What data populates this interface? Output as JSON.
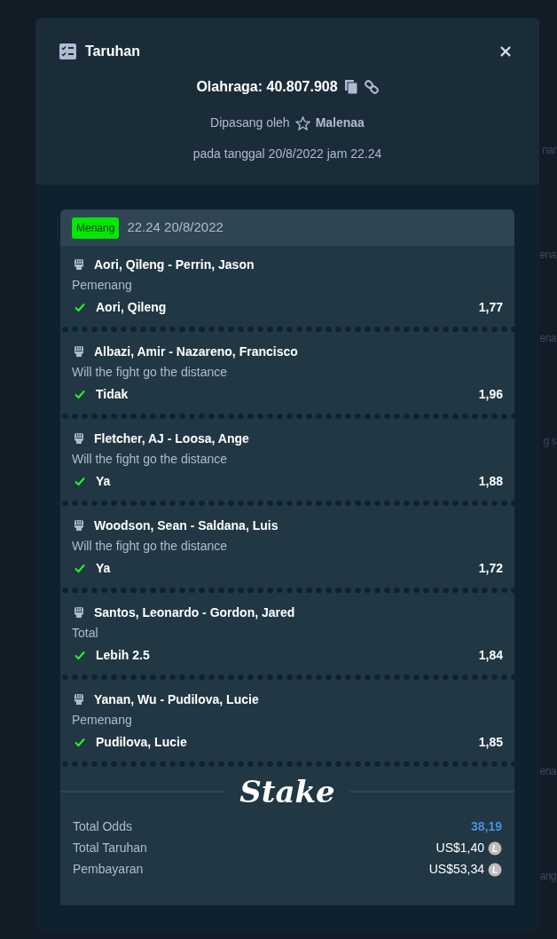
{
  "background": {
    "fragments": [
      {
        "text": "nar"
      },
      {
        "text": "ena"
      },
      {
        "text": "ena"
      },
      {
        "text": "g s"
      },
      {
        "text": "ena"
      },
      {
        "text": "ang"
      }
    ]
  },
  "modal": {
    "title": "Taruhan",
    "bet_id": "Olahraga: 40.807.908",
    "placed_by_label": "Dipasang oleh",
    "user": "Malenaa",
    "placed_at": "pada tanggal 20/8/2022 jam 22.24"
  },
  "ticket": {
    "status": "Menang",
    "won": true,
    "date": "22.24 20/8/2022",
    "legs": [
      {
        "event": "Aori, Qileng - Perrin, Jason",
        "market": "Pemenang",
        "selection": "Aori, Qileng",
        "odds": "1,77",
        "won": true
      },
      {
        "event": "Albazi, Amir - Nazareno, Francisco",
        "market": "Will the fight go the distance",
        "selection": "Tidak",
        "odds": "1,96",
        "won": true
      },
      {
        "event": "Fletcher, AJ - Loosa, Ange",
        "market": "Will the fight go the distance",
        "selection": "Ya",
        "odds": "1,88",
        "won": true
      },
      {
        "event": "Woodson, Sean - Saldana, Luis",
        "market": "Will the fight go the distance",
        "selection": "Ya",
        "odds": "1,72",
        "won": true
      },
      {
        "event": "Santos, Leonardo - Gordon, Jared",
        "market": "Total",
        "selection": "Lebih 2.5",
        "odds": "1,84",
        "won": true
      },
      {
        "event": "Yanan, Wu - Pudilova, Lucie",
        "market": "Pemenang",
        "selection": "Pudilova, Lucie",
        "odds": "1,85",
        "won": true
      }
    ],
    "brand": "Stake",
    "summary": [
      {
        "label": "Total Odds",
        "value": "38,19",
        "kind": "odds"
      },
      {
        "label": "Total Taruhan",
        "value": "US$1,40",
        "kind": "amount"
      },
      {
        "label": "Pembayaran",
        "value": "US$53,34",
        "kind": "amount"
      }
    ]
  }
}
